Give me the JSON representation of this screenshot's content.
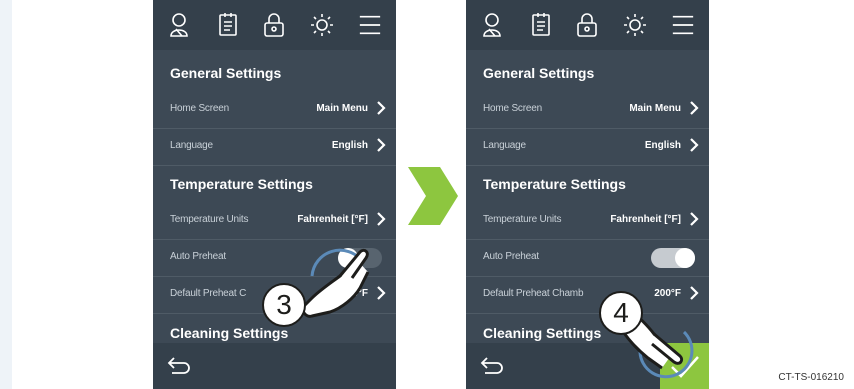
{
  "screen_before": {
    "general_settings": "General Settings",
    "home_screen_label": "Home Screen",
    "home_screen_value": "Main Menu",
    "language_label": "Language",
    "language_value": "English",
    "temperature_settings": "Temperature Settings",
    "temperature_units_label": "Temperature Units",
    "temperature_units_value": "Fahrenheit [°F]",
    "auto_preheat_label": "Auto Preheat",
    "auto_preheat_state": "off",
    "default_preheat_label": "Default Preheat C",
    "default_preheat_value": "200°F",
    "cleaning_settings": "Cleaning Settings"
  },
  "screen_after": {
    "general_settings": "General Settings",
    "home_screen_label": "Home Screen",
    "home_screen_value": "Main Menu",
    "language_label": "Language",
    "language_value": "English",
    "temperature_settings": "Temperature Settings",
    "temperature_units_label": "Temperature Units",
    "temperature_units_value": "Fahrenheit [°F]",
    "auto_preheat_label": "Auto Preheat",
    "auto_preheat_state": "on",
    "default_preheat_label": "Default Preheat Chamb",
    "default_preheat_value": "200°F",
    "cleaning_settings": "Cleaning Settings"
  },
  "steps": {
    "step_a": "3",
    "step_b": "4"
  },
  "icons": [
    "chef-icon",
    "recipe-book-icon",
    "lock-icon",
    "brightness-icon",
    "menu-icon",
    "back-icon",
    "check-icon",
    "chevron-right-icon"
  ],
  "colors": {
    "panel": "#3d4955",
    "bar": "#34404b",
    "accent": "#8dc63f"
  },
  "figure_code": "CT-TS-016210"
}
